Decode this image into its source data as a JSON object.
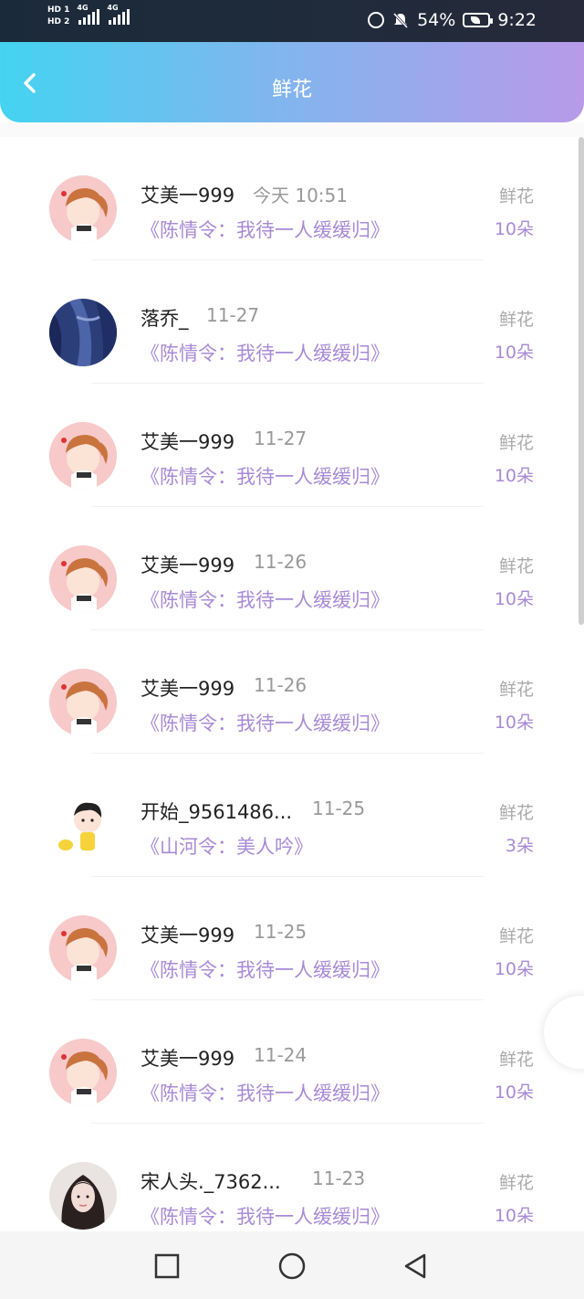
{
  "status_bar": {
    "sim1": "HD 1",
    "sim2": "HD 2",
    "network1": "4G",
    "network2": "4G",
    "battery": "54%",
    "time": "9:22",
    "icons": [
      "alarm-icon",
      "mute-icon",
      "battery-icon"
    ]
  },
  "header": {
    "title": "鲜花",
    "back_icon": "chevron-left-icon",
    "gradient": [
      "#44d3f1",
      "#b89ae9"
    ]
  },
  "list": [
    {
      "name": "艾美一999",
      "time": "今天 10:51",
      "work": "《陈情令：我待一人缓缓归》",
      "gift": "鲜花",
      "count": "10朵",
      "avatar": "girl-cartoon"
    },
    {
      "name": "落乔_",
      "time": "11-27",
      "work": "《陈情令：我待一人缓缓归》",
      "gift": "鲜花",
      "count": "10朵",
      "avatar": "blue-fabric"
    },
    {
      "name": "艾美一999",
      "time": "11-27",
      "work": "《陈情令：我待一人缓缓归》",
      "gift": "鲜花",
      "count": "10朵",
      "avatar": "girl-cartoon"
    },
    {
      "name": "艾美一999",
      "time": "11-26",
      "work": "《陈情令：我待一人缓缓归》",
      "gift": "鲜花",
      "count": "10朵",
      "avatar": "girl-cartoon"
    },
    {
      "name": "艾美一999",
      "time": "11-26",
      "work": "《陈情令：我待一人缓缓归》",
      "gift": "鲜花",
      "count": "10朵",
      "avatar": "girl-cartoon"
    },
    {
      "name": "开始_9561486...",
      "time": "11-25",
      "work": "《山河令：美人吟》",
      "gift": "鲜花",
      "count": "3朵",
      "avatar": "boy-cartoon"
    },
    {
      "name": "艾美一999",
      "time": "11-25",
      "work": "《陈情令：我待一人缓缓归》",
      "gift": "鲜花",
      "count": "10朵",
      "avatar": "girl-cartoon"
    },
    {
      "name": "艾美一999",
      "time": "11-24",
      "work": "《陈情令：我待一人缓缓归》",
      "gift": "鲜花",
      "count": "10朵",
      "avatar": "girl-cartoon"
    },
    {
      "name": "宋人头._7362...",
      "time": "11-23",
      "work": "《陈情令：我待一人缓缓归》",
      "gift": "鲜花",
      "count": "10朵",
      "avatar": "woman-photo"
    }
  ],
  "colors": {
    "accent_purple": "#a88ad6",
    "name_text": "#222222",
    "muted_text": "#999999"
  },
  "nav_bar": {
    "icons": [
      "recent-apps-icon",
      "home-icon",
      "back-icon"
    ]
  }
}
